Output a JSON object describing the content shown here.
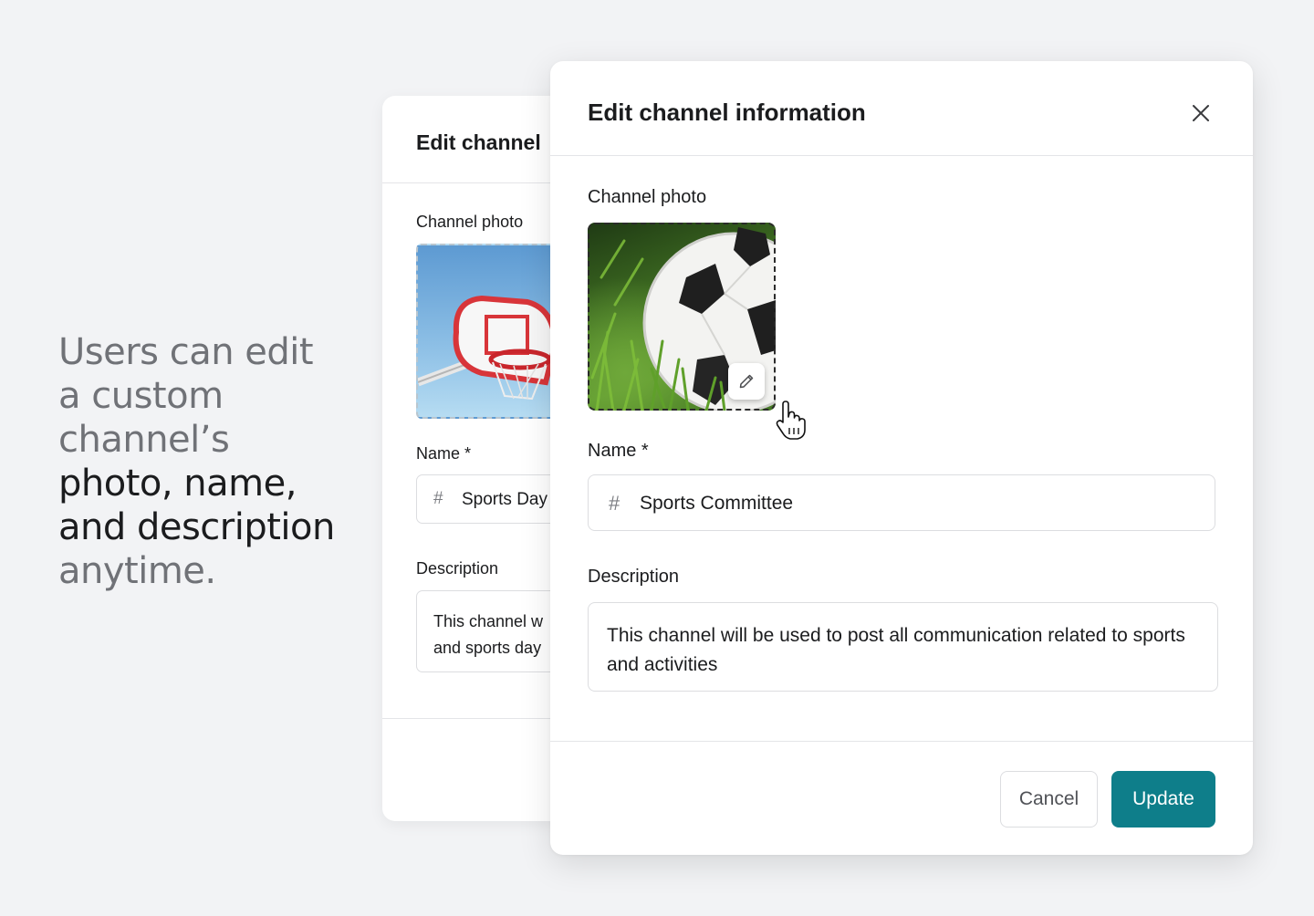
{
  "headline": {
    "line1": "Users can edit",
    "line2": "a custom",
    "line3": "channel’s",
    "line4": "photo, name,",
    "line5": "and description",
    "line6": "anytime."
  },
  "back_card": {
    "title": "Edit channel",
    "photo_label": "Channel photo",
    "name_label": "Name *",
    "name_prefix": "#",
    "name_value": "Sports Day",
    "description_label": "Description",
    "description_line1": "This channel w",
    "description_line2": "and sports day"
  },
  "modal": {
    "title": "Edit channel information",
    "photo_label": "Channel photo",
    "name_label": "Name *",
    "name_prefix": "#",
    "name_value": "Sports Committee",
    "description_label": "Description",
    "description_value": "This channel will be used to post all communication related to sports and activities",
    "cancel_label": "Cancel",
    "update_label": "Update"
  },
  "icons": {
    "close": "close-icon",
    "edit": "pencil-icon",
    "cursor": "hand-pointer-icon"
  },
  "colors": {
    "accent": "#0e7e8a",
    "background": "#f2f3f5",
    "muted_text": "#707277"
  }
}
